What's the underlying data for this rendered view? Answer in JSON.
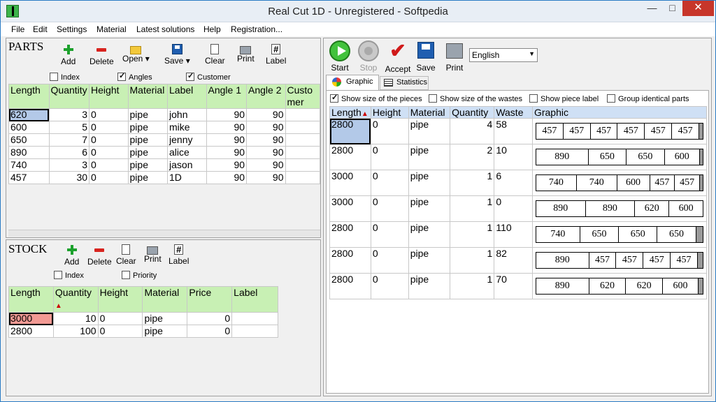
{
  "window": {
    "title": "Real Cut 1D - Unregistered - Softpedia",
    "minimize": "—",
    "maximize": "□",
    "close": "✕"
  },
  "menu": [
    "File",
    "Edit",
    "Settings",
    "Material",
    "Latest solutions",
    "Help",
    "Registration..."
  ],
  "parts": {
    "heading": "PARTS",
    "toolbar": [
      "Add",
      "Delete",
      "Open",
      "Save",
      "Clear",
      "Print",
      "Label"
    ],
    "options": [
      {
        "label": "Index",
        "checked": false
      },
      {
        "label": "Angles",
        "checked": true
      },
      {
        "label": "Customer",
        "checked": true
      }
    ],
    "columns": [
      "Length",
      "Quantity",
      "Height",
      "Material",
      "Label",
      "Angle 1",
      "Angle 2",
      "Customer"
    ],
    "rows": [
      [
        "620",
        "3",
        "0",
        "pipe",
        "john",
        "90",
        "90",
        ""
      ],
      [
        "600",
        "5",
        "0",
        "pipe",
        "mike",
        "90",
        "90",
        ""
      ],
      [
        "650",
        "7",
        "0",
        "pipe",
        "jenny",
        "90",
        "90",
        ""
      ],
      [
        "890",
        "6",
        "0",
        "pipe",
        "alice",
        "90",
        "90",
        ""
      ],
      [
        "740",
        "3",
        "0",
        "pipe",
        "jason",
        "90",
        "90",
        ""
      ],
      [
        "457",
        "30",
        "0",
        "pipe",
        "1D",
        "90",
        "90",
        ""
      ]
    ]
  },
  "stock": {
    "heading": "STOCK",
    "toolbar": [
      "Add",
      "Delete",
      "Clear",
      "Print",
      "Label"
    ],
    "options": [
      {
        "label": "Index",
        "checked": false
      },
      {
        "label": "Priority",
        "checked": false
      }
    ],
    "columns": [
      "Length",
      "Quantity",
      "Height",
      "Material",
      "Price",
      "Label"
    ],
    "rows": [
      [
        "3000",
        "10",
        "0",
        "pipe",
        "0",
        ""
      ],
      [
        "2800",
        "100",
        "0",
        "pipe",
        "0",
        ""
      ]
    ]
  },
  "solution": {
    "toolbar": [
      "Start",
      "Stop",
      "Accept",
      "Save",
      "Print"
    ],
    "language": "English",
    "tabs": [
      "Graphic",
      "Statistics"
    ],
    "options": [
      {
        "label": "Show size of the pieces",
        "checked": true
      },
      {
        "label": "Show size of the wastes",
        "checked": false
      },
      {
        "label": "Show piece label",
        "checked": false
      },
      {
        "label": "Group identical parts",
        "checked": false
      }
    ],
    "columns": [
      "Length",
      "Height",
      "Material",
      "Quantity",
      "Waste",
      "Graphic"
    ],
    "rows": [
      {
        "length": "2800",
        "height": "0",
        "material": "pipe",
        "quantity": "4",
        "waste": "58",
        "pieces": [
          "457",
          "457",
          "457",
          "457",
          "457",
          "457"
        ],
        "waste_fraction": 0.021
      },
      {
        "length": "2800",
        "height": "0",
        "material": "pipe",
        "quantity": "2",
        "waste": "10",
        "pieces": [
          "890",
          "650",
          "650",
          "600"
        ],
        "waste_fraction": 0.004
      },
      {
        "length": "3000",
        "height": "0",
        "material": "pipe",
        "quantity": "1",
        "waste": "6",
        "pieces": [
          "740",
          "740",
          "600",
          "457",
          "457"
        ],
        "waste_fraction": 0.002
      },
      {
        "length": "3000",
        "height": "0",
        "material": "pipe",
        "quantity": "1",
        "waste": "0",
        "pieces": [
          "890",
          "890",
          "620",
          "600"
        ],
        "waste_fraction": 0
      },
      {
        "length": "2800",
        "height": "0",
        "material": "pipe",
        "quantity": "1",
        "waste": "110",
        "pieces": [
          "740",
          "650",
          "650",
          "650"
        ],
        "waste_fraction": 0.039
      },
      {
        "length": "2800",
        "height": "0",
        "material": "pipe",
        "quantity": "1",
        "waste": "82",
        "pieces": [
          "890",
          "457",
          "457",
          "457",
          "457"
        ],
        "waste_fraction": 0.029
      },
      {
        "length": "2800",
        "height": "0",
        "material": "pipe",
        "quantity": "1",
        "waste": "70",
        "pieces": [
          "890",
          "620",
          "620",
          "600"
        ],
        "waste_fraction": 0.025
      }
    ]
  }
}
